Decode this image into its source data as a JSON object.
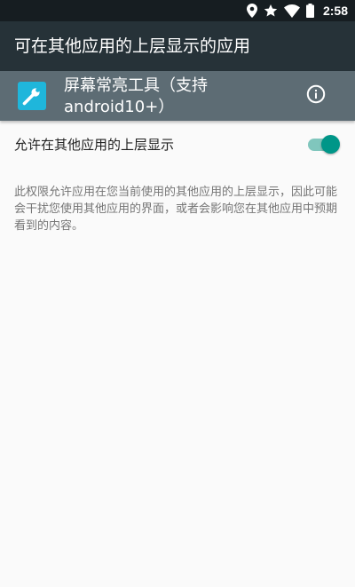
{
  "status_bar": {
    "time": "2:58",
    "icons": [
      "location-icon",
      "star-icon",
      "wifi-icon",
      "battery-icon"
    ]
  },
  "app_bar": {
    "title": "可在其他应用的上层显示的应用"
  },
  "app_header": {
    "icon": "wrench-icon",
    "name": "屏幕常亮工具（支持android10+）",
    "info_icon": "info-icon"
  },
  "setting": {
    "label": "允许在其他应用的上层显示",
    "enabled": true
  },
  "description": "此权限允许应用在您当前使用的其他应用的上层显示，因此可能会干扰您使用其他应用的界面，或者会影响您在其他应用中预期看到的内容。",
  "colors": {
    "status_bar": "#161d21",
    "app_bar": "#263238",
    "app_header": "#5d6c74",
    "app_icon": "#1fb6db",
    "switch_accent": "#009688",
    "background": "#fafafa"
  }
}
